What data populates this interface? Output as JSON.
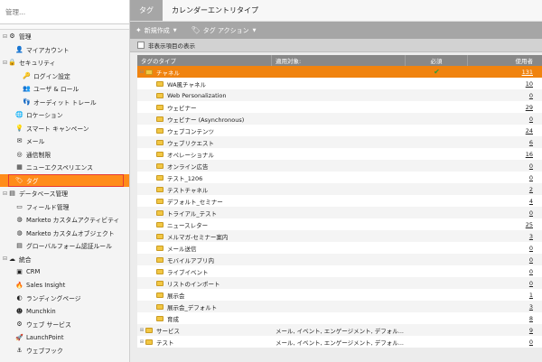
{
  "sidebar": {
    "search_placeholder": "管理...",
    "items": [
      {
        "label": "管理",
        "icon": "gear-icon",
        "glyph": "⚙",
        "toggle": "⊟",
        "indent": 0
      },
      {
        "label": "マイアカウント",
        "icon": "person-icon",
        "glyph": "👤",
        "toggle": "",
        "indent": 1
      },
      {
        "label": "セキュリティ",
        "icon": "lock-icon",
        "glyph": "🔒",
        "toggle": "⊟",
        "indent": 0
      },
      {
        "label": "ログイン設定",
        "icon": "key-icon",
        "glyph": "🔑",
        "toggle": "",
        "indent": 2
      },
      {
        "label": "ユーザ & ロール",
        "icon": "users-icon",
        "glyph": "👥",
        "toggle": "",
        "indent": 2
      },
      {
        "label": "オーディット トレール",
        "icon": "footprints-icon",
        "glyph": "👣",
        "toggle": "",
        "indent": 2
      },
      {
        "label": "ロケーション",
        "icon": "globe-icon",
        "glyph": "🌐",
        "toggle": "",
        "indent": 1
      },
      {
        "label": "スマート キャンペーン",
        "icon": "lightbulb-icon",
        "glyph": "💡",
        "toggle": "",
        "indent": 1
      },
      {
        "label": "メール",
        "icon": "envelope-icon",
        "glyph": "✉",
        "toggle": "",
        "indent": 1
      },
      {
        "label": "通信制限",
        "icon": "limit-icon",
        "glyph": "◎",
        "toggle": "",
        "indent": 1
      },
      {
        "label": "ニューエクスペリエンス",
        "icon": "experience-icon",
        "glyph": "▦",
        "toggle": "",
        "indent": 1
      },
      {
        "label": "タグ",
        "icon": "tag-icon",
        "glyph": "🏷",
        "toggle": "",
        "indent": 1,
        "active": true
      },
      {
        "label": "データベース管理",
        "icon": "database-icon",
        "glyph": "▤",
        "toggle": "⊟",
        "indent": 0
      },
      {
        "label": "フィールド管理",
        "icon": "field-icon",
        "glyph": "▭",
        "toggle": "",
        "indent": 1
      },
      {
        "label": "Marketo カスタムアクティビティ",
        "icon": "activity-icon",
        "glyph": "◍",
        "toggle": "",
        "indent": 1
      },
      {
        "label": "Marketo カスタムオブジェクト",
        "icon": "object-icon",
        "glyph": "◍",
        "toggle": "",
        "indent": 1
      },
      {
        "label": "グローバルフォーム認証ルール",
        "icon": "form-icon",
        "glyph": "▤",
        "toggle": "",
        "indent": 1
      },
      {
        "label": "統合",
        "icon": "integration-icon",
        "glyph": "☁",
        "toggle": "⊟",
        "indent": 0
      },
      {
        "label": "CRM",
        "icon": "crm-icon",
        "glyph": "▣",
        "toggle": "",
        "indent": 1
      },
      {
        "label": "Sales Insight",
        "icon": "flame-icon",
        "glyph": "🔥",
        "toggle": "",
        "indent": 1
      },
      {
        "label": "ランディングページ",
        "icon": "page-icon",
        "glyph": "◐",
        "toggle": "",
        "indent": 1
      },
      {
        "label": "Munchkin",
        "icon": "munchkin-icon",
        "glyph": "☻",
        "toggle": "",
        "indent": 1
      },
      {
        "label": "ウェブ サービス",
        "icon": "webservice-icon",
        "glyph": "⚙",
        "toggle": "",
        "indent": 1
      },
      {
        "label": "LaunchPoint",
        "icon": "rocket-icon",
        "glyph": "🚀",
        "toggle": "",
        "indent": 1
      },
      {
        "label": "ウェブフック",
        "icon": "webhook-icon",
        "glyph": "⚓",
        "toggle": "",
        "indent": 1
      }
    ]
  },
  "tabs": [
    "タグ",
    "カレンダーエントリタイプ"
  ],
  "toolbar": {
    "new_label": "新規作成",
    "action_label": "タグ アクション"
  },
  "show_hidden_label": "非表示項目の表示",
  "table": {
    "headers": [
      "タグのタイプ",
      "適用対象:",
      "必須",
      "使用者"
    ],
    "rows": [
      {
        "name": "チャネル",
        "indent": 0,
        "toggle": "⊟",
        "applies": "",
        "required": "✔",
        "used": "131",
        "sel": true
      },
      {
        "name": "WA風チャネル",
        "indent": 1,
        "toggle": "",
        "applies": "",
        "required": "",
        "used": "10"
      },
      {
        "name": "Web Personalization",
        "indent": 1,
        "toggle": "",
        "applies": "",
        "required": "",
        "used": "0"
      },
      {
        "name": "ウェビナー",
        "indent": 1,
        "toggle": "",
        "applies": "",
        "required": "",
        "used": "29"
      },
      {
        "name": "ウェビナー (Asynchronous)",
        "indent": 1,
        "toggle": "",
        "applies": "",
        "required": "",
        "used": "0"
      },
      {
        "name": "ウェブコンテンツ",
        "indent": 1,
        "toggle": "",
        "applies": "",
        "required": "",
        "used": "24"
      },
      {
        "name": "ウェブリクエスト",
        "indent": 1,
        "toggle": "",
        "applies": "",
        "required": "",
        "used": "6"
      },
      {
        "name": "オペレーショナル",
        "indent": 1,
        "toggle": "",
        "applies": "",
        "required": "",
        "used": "16"
      },
      {
        "name": "オンライン広告",
        "indent": 1,
        "toggle": "",
        "applies": "",
        "required": "",
        "used": "0"
      },
      {
        "name": "テスト_1206",
        "indent": 1,
        "toggle": "",
        "applies": "",
        "required": "",
        "used": "0"
      },
      {
        "name": "テストチャネル",
        "indent": 1,
        "toggle": "",
        "applies": "",
        "required": "",
        "used": "2"
      },
      {
        "name": "デフォルト_セミナー",
        "indent": 1,
        "toggle": "",
        "applies": "",
        "required": "",
        "used": "4"
      },
      {
        "name": "トライアル_テスト",
        "indent": 1,
        "toggle": "",
        "applies": "",
        "required": "",
        "used": "0"
      },
      {
        "name": "ニュースレター",
        "indent": 1,
        "toggle": "",
        "applies": "",
        "required": "",
        "used": "25"
      },
      {
        "name": "メルマガ-セミナー案内",
        "indent": 1,
        "toggle": "",
        "applies": "",
        "required": "",
        "used": "3"
      },
      {
        "name": "メール送信",
        "indent": 1,
        "toggle": "",
        "applies": "",
        "required": "",
        "used": "0"
      },
      {
        "name": "モバイルアプリ内",
        "indent": 1,
        "toggle": "",
        "applies": "",
        "required": "",
        "used": "0"
      },
      {
        "name": "ライブイベント",
        "indent": 1,
        "toggle": "",
        "applies": "",
        "required": "",
        "used": "0"
      },
      {
        "name": "リストのインポート",
        "indent": 1,
        "toggle": "",
        "applies": "",
        "required": "",
        "used": "0"
      },
      {
        "name": "展示会",
        "indent": 1,
        "toggle": "",
        "applies": "",
        "required": "",
        "used": "1"
      },
      {
        "name": "展示会_デフォルト",
        "indent": 1,
        "toggle": "",
        "applies": "",
        "required": "",
        "used": "3"
      },
      {
        "name": "育成",
        "indent": 1,
        "toggle": "",
        "applies": "",
        "required": "",
        "used": "8"
      },
      {
        "name": "サービス",
        "indent": 0,
        "toggle": "⊞",
        "applies": "メール, イベント, エンゲージメント, デフォル...",
        "required": "",
        "used": "9"
      },
      {
        "name": "テスト",
        "indent": 0,
        "toggle": "⊞",
        "applies": "メール, イベント, エンゲージメント, デフォル...",
        "required": "",
        "used": "0"
      }
    ]
  }
}
